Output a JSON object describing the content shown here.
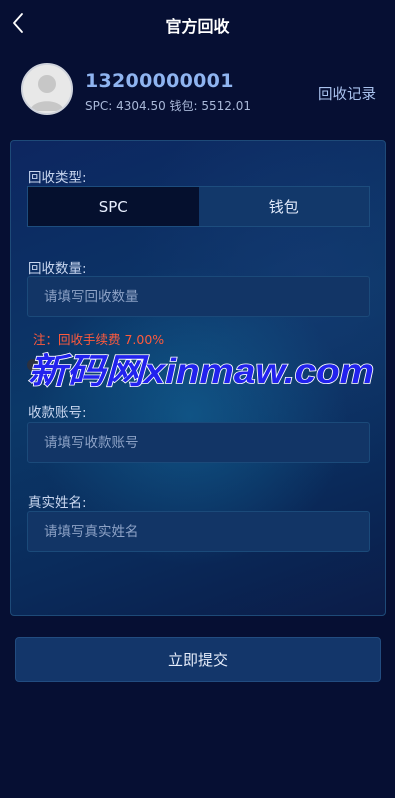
{
  "header": {
    "title": "官方回收",
    "back_icon": "chevron-left-icon"
  },
  "user": {
    "avatar_icon": "default-user-avatar-icon",
    "phone": "13200000001",
    "balances": "SPC: 4304.50 钱包: 5512.01"
  },
  "records_link": "回收记录",
  "form": {
    "type_label": "回收类型:",
    "type_options": [
      "SPC",
      "钱包"
    ],
    "selected_type": "SPC",
    "amount_label": "回收数量:",
    "amount_placeholder": "请填写回收数量",
    "fee_note": "注：回收手续费 7.00%",
    "account_label": "收款账号:",
    "account_placeholder": "请填写收款账号",
    "name_label": "真实姓名:",
    "name_placeholder": "请填写真实姓名"
  },
  "watermark": "新码网xinmaw.com",
  "submit_label": "立即提交",
  "colors": {
    "background": "#060f33",
    "accent_text": "#8fb4f0",
    "note": "#ff5a3c",
    "watermark": "#2222ee"
  }
}
